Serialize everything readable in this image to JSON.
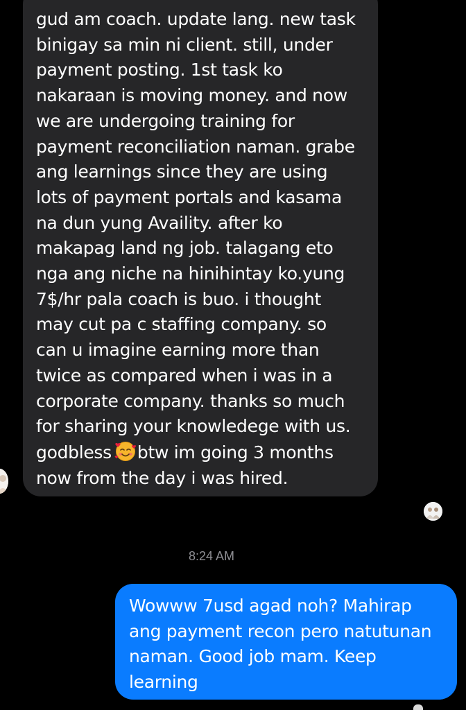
{
  "incoming_message": {
    "text_before_emoji": "gud am coach. update lang. new task\nbinigay sa min ni client. still, under\npayment posting. 1st task ko\nnakaraan is moving money. and now\nwe are undergoing training for\npayment reconciliation naman. grabe\nang learnings since they are using\nlots of payment portals and kasama\nna dun yung Availity. after ko\nmakapag land ng job. talagang eto\nnga ang niche na hinihintay ko.yung\n7$/hr pala coach is buo. i thought\nmay cut pa c staffing company. so\ncan u imagine earning more than\ntwice as compared when i was in a\ncorporate company. thanks so much\nfor sharing your knowledege with us.\ngodbless",
    "emoji": "smiling-face-with-hearts",
    "text_after_emoji": "btw im going 3 months\nnow from the day i was hired."
  },
  "timestamp": "8:24 AM",
  "outgoing_message": {
    "text": "Wowww 7usd agad noh? Mahirap\nang payment recon pero natutunan\nnaman. Good job mam. Keep\nlearning"
  },
  "colors": {
    "background": "#000000",
    "incoming_bubble": "#262628",
    "outgoing_bubble": "#0a7cff",
    "timestamp": "#8e8e93",
    "text": "#ffffff"
  }
}
